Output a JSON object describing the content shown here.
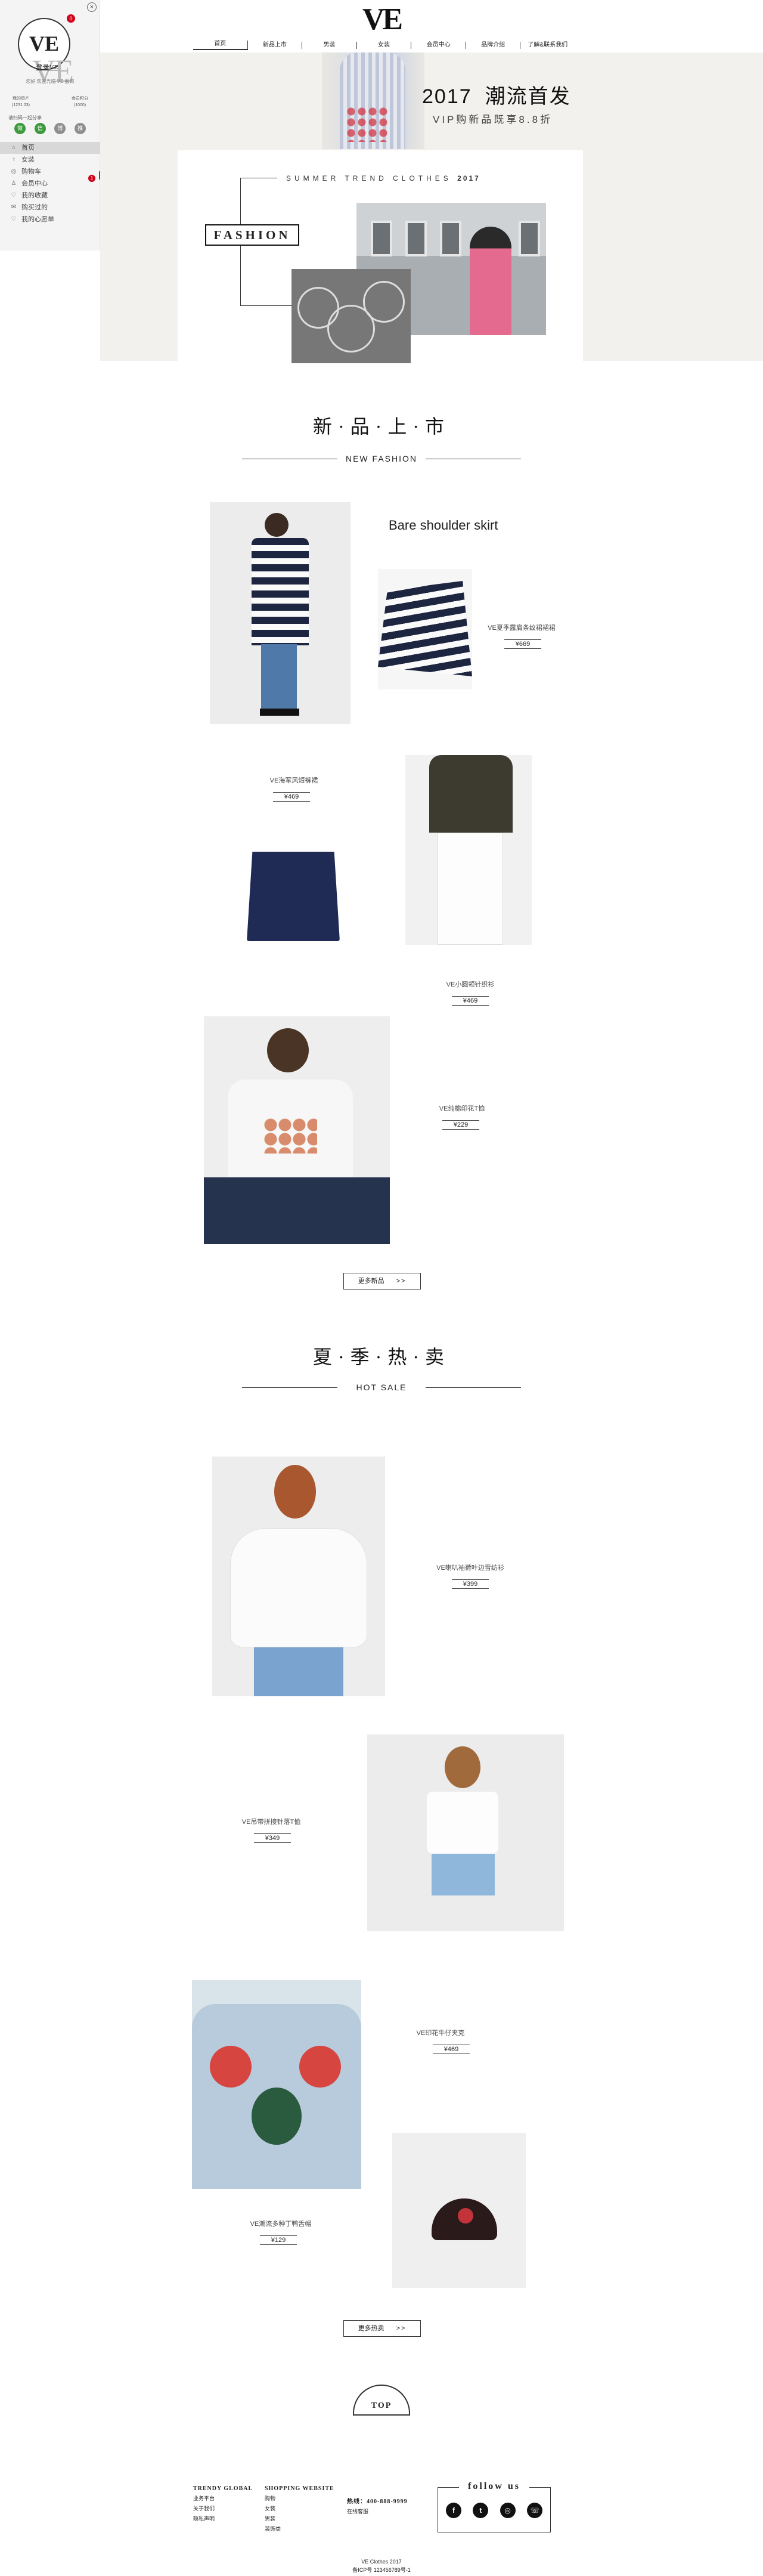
{
  "sidebar": {
    "logo": "VE",
    "logo_big": "VE",
    "login": "登录VE",
    "badge": "0",
    "close": "×",
    "welcome": "您好 欢迎光临 VE 服饰",
    "accounts": [
      {
        "top": "我的资产",
        "bottom": "(1231.03)"
      },
      {
        "top": "会员积分",
        "bottom": "(1000)"
      }
    ],
    "social_title": "请扫码一起分享",
    "social": [
      "微",
      "信",
      "博",
      "推"
    ],
    "menu": [
      {
        "icon": "⌂",
        "label": "首页"
      },
      {
        "icon": "♀",
        "label": "女装"
      },
      {
        "icon": "◎",
        "label": "购物车"
      },
      {
        "icon": "♙",
        "label": "会员中心"
      },
      {
        "icon": "♡",
        "label": "我的收藏"
      },
      {
        "icon": "✉",
        "label": "购买过的"
      },
      {
        "icon": "♡",
        "label": "我的心愿单"
      }
    ],
    "menu_badge": "1",
    "collapse": "◂"
  },
  "header": {
    "brand": "VE",
    "nav": [
      "首页",
      "新品上市",
      "男装",
      "女装",
      "会员中心",
      "品牌介绍",
      "了解&联系我们"
    ]
  },
  "hero": {
    "year": "2017",
    "title_cn": "潮流首发",
    "subtitle": "VIP购新品既享8.8折",
    "summer": "SUMMER TREND CLOTHES",
    "summer_year": "2017",
    "fashion": "FASHION"
  },
  "new_section": {
    "title": "新·品·上·市",
    "subtitle": "NEW FASHION",
    "headline_en": "Bare shoulder skirt",
    "products": [
      {
        "name": "VE夏季露肩条纹裙裙裙",
        "price": "¥669"
      },
      {
        "name": "VE海军风短裤裙",
        "price": "¥469"
      },
      {
        "name": "VE小圆领针织衫",
        "price": "¥469"
      },
      {
        "name": "VE纯棉印花T恤",
        "price": "¥229"
      }
    ],
    "more": "更多新品",
    "more_arrow": ">>"
  },
  "hot_section": {
    "title": "夏·季·热·卖",
    "subtitle": "HOT SALE",
    "products": [
      {
        "name": "VE喇叭袖荷叶边雪纺衫",
        "price": "¥399"
      },
      {
        "name": "VE吊带拼接针落T恤",
        "price": "¥349"
      },
      {
        "name": "VE印花牛仔夹克",
        "price": "¥469"
      },
      {
        "name": "VE潮流多种丁鸭舌帽",
        "price": "¥129"
      }
    ],
    "more": "更多热卖",
    "more_arrow": ">>"
  },
  "top_button": "TOP",
  "footer": {
    "col1": {
      "title": "TRENDY GLOBAL",
      "items": [
        "业务平台",
        "关于我们",
        "隐私声明"
      ]
    },
    "col2": {
      "title": "SHOPPING WEBSITE",
      "items": [
        "购物",
        "女装",
        "男装",
        "装饰类"
      ]
    },
    "col3": {
      "title": "热线：400-888-9999",
      "items": [
        "在线客服"
      ]
    },
    "follow": "follow us",
    "follow_icons": [
      "f",
      "t",
      "◎",
      "☏"
    ],
    "copyright": "VE Clothes 2017",
    "icp": "备ICP号 123456789号-1"
  }
}
